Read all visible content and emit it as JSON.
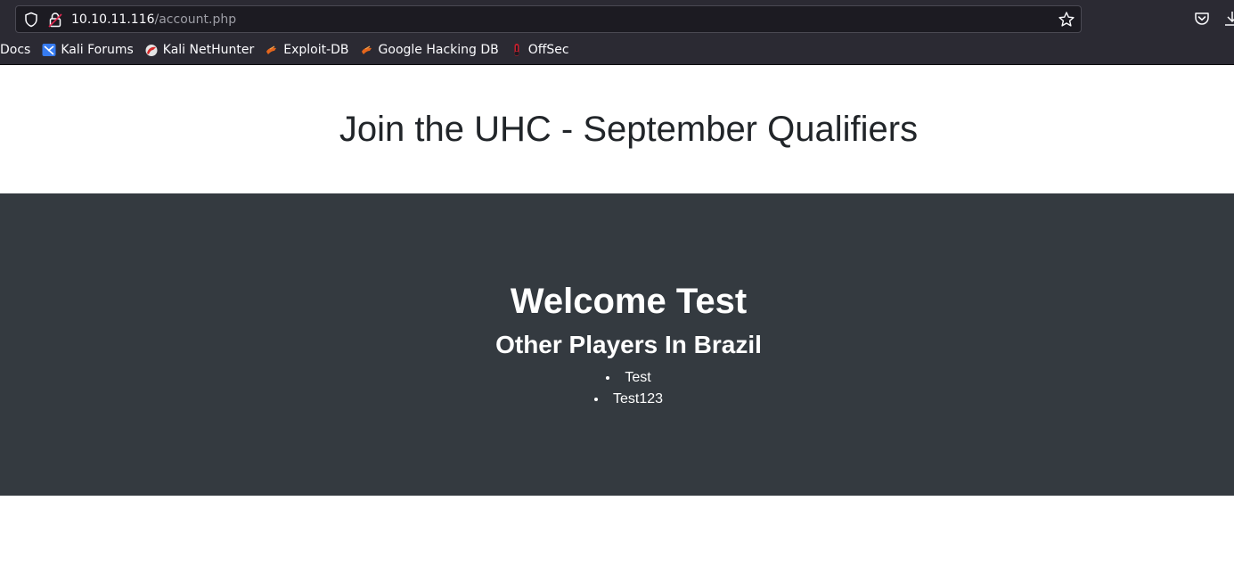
{
  "browser": {
    "url_host": "10.10.11.116",
    "url_path": "/account.php",
    "bookmarks": [
      {
        "label": "Docs",
        "icon": "none"
      },
      {
        "label": "Kali Forums",
        "icon": "kali-forums-icon"
      },
      {
        "label": "Kali NetHunter",
        "icon": "kali-nethunter-icon"
      },
      {
        "label": "Exploit-DB",
        "icon": "exploit-db-icon"
      },
      {
        "label": "Google Hacking DB",
        "icon": "ghdb-icon"
      },
      {
        "label": "OffSec",
        "icon": "offsec-icon"
      }
    ]
  },
  "page": {
    "title": "Join the UHC - September Qualifiers",
    "welcome": "Welcome Test",
    "subtitle": "Other Players In Brazil",
    "players": [
      "Test",
      "Test123"
    ]
  },
  "colors": {
    "chrome_bg": "#2b2a33",
    "urlbar_bg": "#1c1b22",
    "dark_section": "#343a40",
    "title_text": "#212529"
  }
}
